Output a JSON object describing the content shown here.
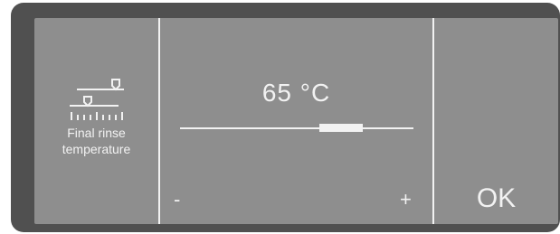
{
  "function": {
    "icon": "temperature-slider-icon",
    "label_line1": "Final rinse",
    "label_line2": "temperature"
  },
  "setting": {
    "value_text": "65 °C",
    "slider_fraction": 0.69
  },
  "controls": {
    "decrease_label": "-",
    "increase_label": "+",
    "ok_label": "OK"
  },
  "colors": {
    "bezel": "#505050",
    "screen": "#8e8e8e",
    "foreground": "#f2f2f2"
  }
}
